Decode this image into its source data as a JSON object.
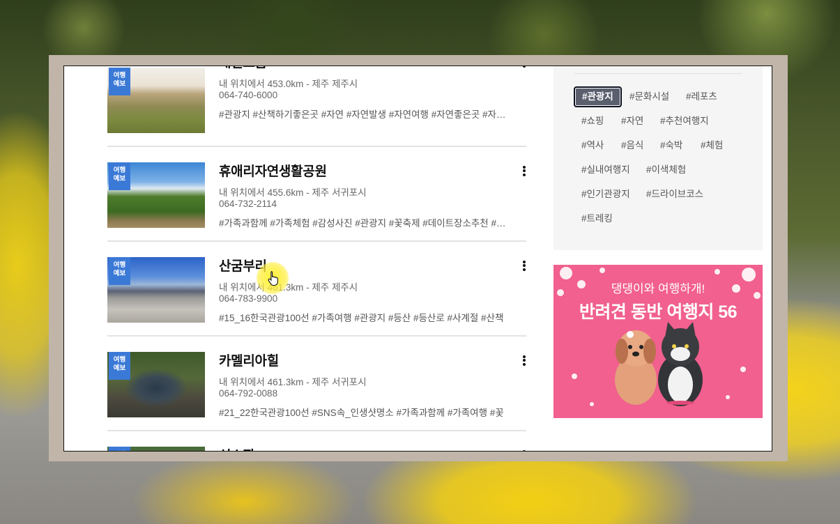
{
  "places": [
    {
      "badge": [
        "여행",
        "예보"
      ],
      "name": "새별오름",
      "distance": "내 위치에서 453.0km - 제주 제주시",
      "phone": "064-740-6000",
      "tags": "#관광지 #산책하기좋은곳 #자연 #자연발생 #자연여행 #자연좋은곳 #자연체험"
    },
    {
      "badge": [
        "여행",
        "예보"
      ],
      "name": "휴애리자연생활공원",
      "distance": "내 위치에서 455.6km - 제주 서귀포시",
      "phone": "064-732-2114",
      "tags": "#가족과함께 #가족체험 #감성사진 #관광지 #꽃축제 #데이트장소추천 #동물"
    },
    {
      "badge": [
        "여행",
        "예보"
      ],
      "name": "산굼부리",
      "distance": "내 위치에서 461.3km - 제주 제주시",
      "phone": "064-783-9900",
      "tags": "#15_16한국관광100선 #가족여행 #관광지 #등산 #등산로 #사계절 #산책"
    },
    {
      "badge": [
        "여행",
        "예보"
      ],
      "name": "카멜리아힐",
      "distance": "내 위치에서 461.3km - 제주 서귀포시",
      "phone": "064-792-0088",
      "tags": "#21_22한국관광100선 #SNS속_인생샷명소 #가족과함께 #가족여행 #꽃"
    },
    {
      "badge": [
        "여행",
        "예보"
      ],
      "name": "신소깍",
      "distance": "",
      "phone": "",
      "tags": ""
    }
  ],
  "tag_filter": {
    "selected": "#관광지",
    "tags": [
      "#관광지",
      "#문화시설",
      "#레포츠",
      "#쇼핑",
      "#자연",
      "#추천여행지",
      "#역사",
      "#음식",
      "#숙박",
      "#체험",
      "#실내여행지",
      "#이색체험",
      "#인기관광지",
      "#드라이브코스",
      "#트레킹"
    ]
  },
  "banner": {
    "subtitle": "댕댕이와 여행하개!",
    "headline": "반려견 동반 여행지 56"
  },
  "colors": {
    "badge": "#3b79d6",
    "selected_tag": "#5a5f6e",
    "banner": "#f1608e",
    "frame": "#c0b5a8"
  }
}
